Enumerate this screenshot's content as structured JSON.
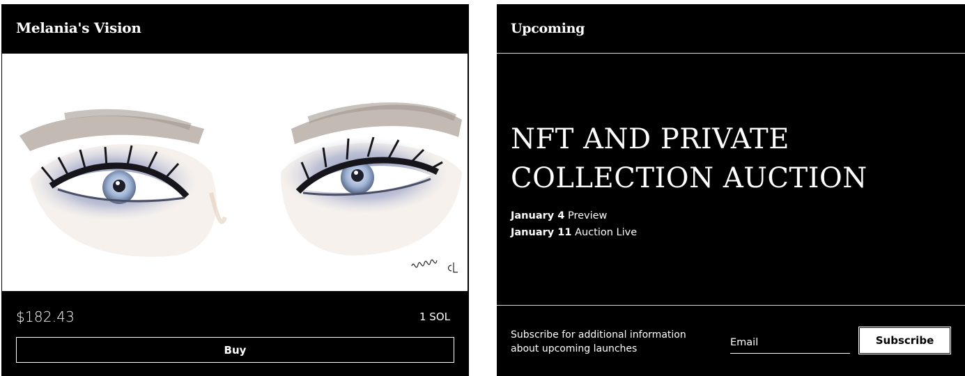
{
  "product": {
    "title": "Melania's Vision",
    "image_alt": "watercolor eyes artwork",
    "price_usd": "$182.43",
    "price_sol": "1 SOL",
    "buy_label": "Buy"
  },
  "upcoming": {
    "section_title": "Upcoming",
    "headline_line1": "NFT AND PRIVATE",
    "headline_line2": "COLLECTION AUCTION",
    "dates": [
      {
        "date": "January 4",
        "event": "Preview"
      },
      {
        "date": "January 11",
        "event": "Auction Live"
      }
    ],
    "subscribe_text": "Subscribe for additional information about upcoming launches",
    "email_placeholder": "Email",
    "subscribe_label": "Subscribe"
  },
  "colors": {
    "card_bg": "#000000",
    "text": "#ffffff",
    "art_bg": "#ffffff"
  }
}
